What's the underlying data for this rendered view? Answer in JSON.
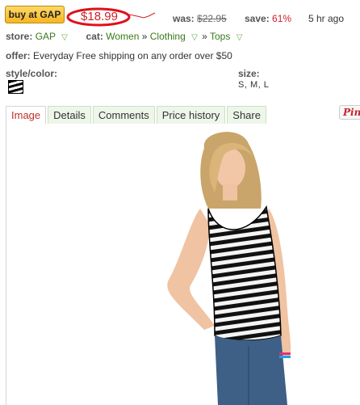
{
  "header": {
    "buy_label": "buy at GAP",
    "price": "$18.99",
    "was_label": "was:",
    "was_value": "$22.95",
    "save_label": "save:",
    "save_value": "61%",
    "time_ago": "5 hr ago",
    "price_color": "#d0202a"
  },
  "meta": {
    "store_label": "store:",
    "store_value": "GAP",
    "cat_label": "cat:",
    "cat_1": "Women",
    "cat_2": "Clothing",
    "cat_3": "Tops",
    "sep": "»"
  },
  "offer": {
    "label": "offer:",
    "text": "Everyday Free shipping on any order over $50"
  },
  "options": {
    "style_label": "style/color:",
    "size_label": "size:",
    "sizes": "S,  M,  L"
  },
  "tabs": [
    "Image",
    "Details",
    "Comments",
    "Price history",
    "Share"
  ],
  "pin_label": "Pin",
  "icons": {
    "filter": "funnel-icon",
    "pin": "pinterest-icon",
    "sparkline": "price-trend-icon"
  }
}
